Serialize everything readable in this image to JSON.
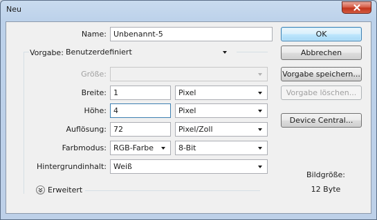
{
  "window": {
    "title": "Neu"
  },
  "form": {
    "name": {
      "label": "Name:",
      "value": "Unbenannt-5"
    },
    "vorgabe": {
      "label": "Vorgabe:",
      "value": "Benutzerdefiniert"
    },
    "groesse": {
      "label": "Größe:",
      "value": ""
    },
    "breite": {
      "label": "Breite:",
      "value": "1",
      "unit": "Pixel"
    },
    "hoehe": {
      "label": "Höhe:",
      "value": "4",
      "unit": "Pixel"
    },
    "aufloesung": {
      "label": "Auflösung:",
      "value": "72",
      "unit": "Pixel/Zoll"
    },
    "farbmodus": {
      "label": "Farbmodus:",
      "value": "RGB-Farbe",
      "depth": "8-Bit"
    },
    "hintergrund": {
      "label": "Hintergrundinhalt:",
      "value": "Weiß"
    },
    "erweitert": {
      "label": "Erweitert"
    }
  },
  "buttons": {
    "ok": "OK",
    "abbrechen": "Abbrechen",
    "vorgabe_speichern": "Vorgabe speichern...",
    "vorgabe_loeschen": "Vorgabe löschen...",
    "device_central": "Device Central..."
  },
  "info": {
    "bildgroesse_label": "Bildgröße:",
    "bildgroesse_value": "12 Byte"
  },
  "icons": {
    "close": "close-icon",
    "dropdown": "chevron-down-icon",
    "expand": "expand-chevron-icon"
  },
  "colors": {
    "close_button": "#c2351d",
    "default_button_border": "#3c7fb1",
    "dialog_background": "#f0f0f0",
    "frame": "#bcd1ea"
  }
}
